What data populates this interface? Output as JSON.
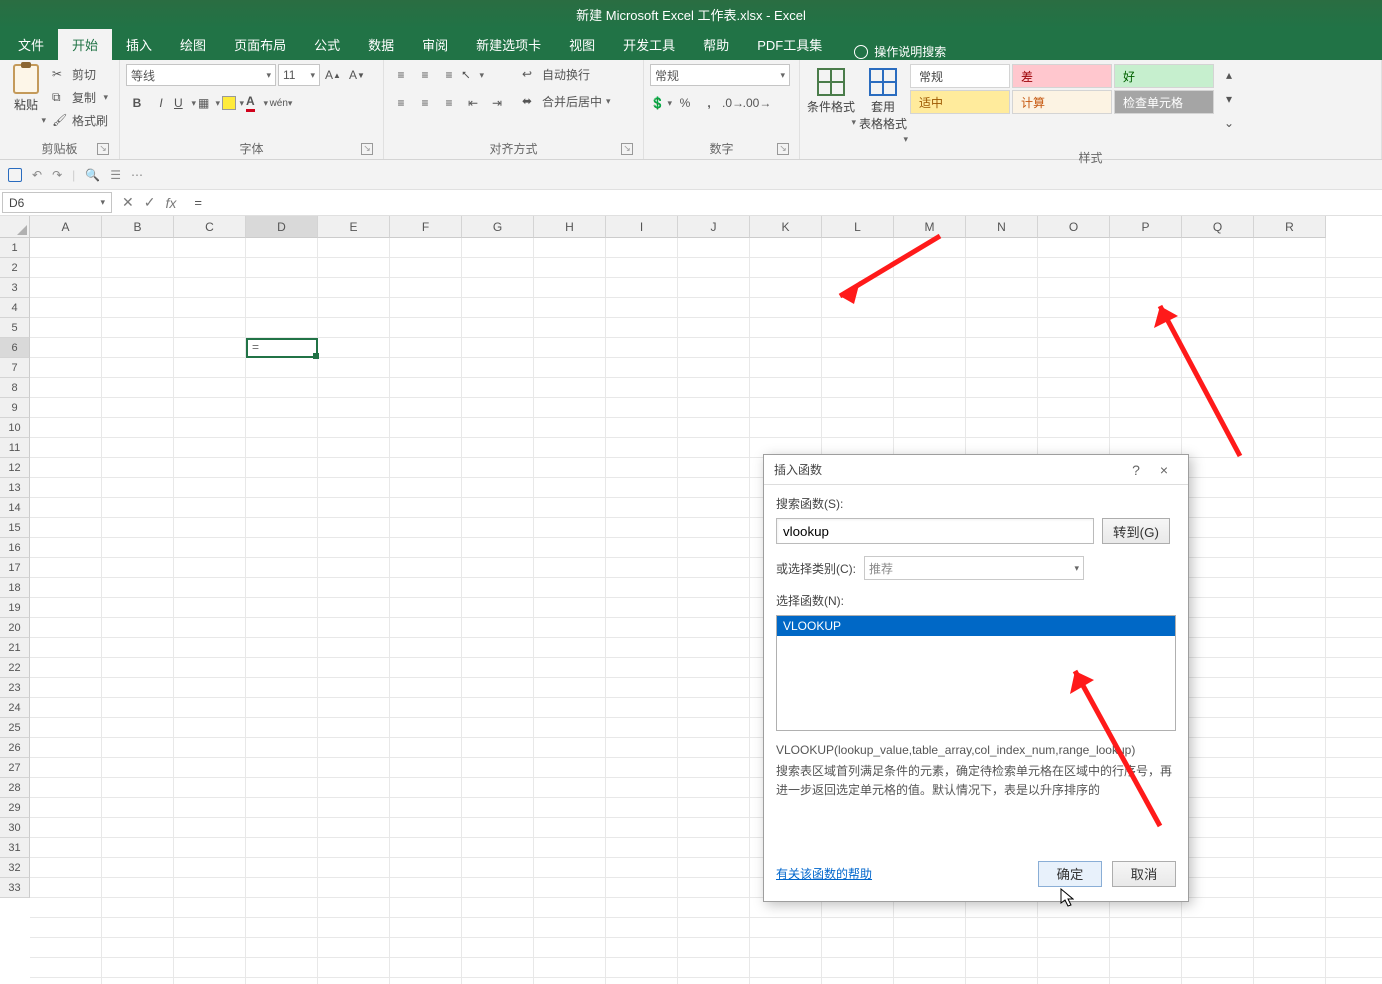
{
  "window": {
    "title": "新建 Microsoft Excel 工作表.xlsx - Excel"
  },
  "tabs": {
    "file": "文件",
    "home": "开始",
    "insert": "插入",
    "draw": "绘图",
    "page_layout": "页面布局",
    "formulas": "公式",
    "data": "数据",
    "review": "审阅",
    "new_tab": "新建选项卡",
    "view": "视图",
    "developer": "开发工具",
    "help": "帮助",
    "pdf": "PDF工具集",
    "tell_me": "操作说明搜索"
  },
  "ribbon": {
    "clipboard": {
      "title": "剪贴板",
      "paste": "粘贴",
      "cut": "剪切",
      "copy": "复制",
      "format_painter": "格式刷"
    },
    "font": {
      "title": "字体",
      "name": "等线",
      "size": "11"
    },
    "alignment": {
      "title": "对齐方式",
      "wrap": "自动换行",
      "merge": "合并后居中"
    },
    "number": {
      "title": "数字",
      "format": "常规"
    },
    "styles": {
      "title": "样式",
      "cond_fmt": "条件格式",
      "table_fmt": "套用\n表格格式",
      "cells": {
        "normal": "常规",
        "bad": "差",
        "good": "好",
        "neutral": "适中",
        "calc": "计算",
        "check": "检查单元格"
      }
    }
  },
  "namebox": "D6",
  "formula": "=",
  "active_cell": {
    "col": "D",
    "row": 6,
    "value": "="
  },
  "columns": [
    "A",
    "B",
    "C",
    "D",
    "E",
    "F",
    "G",
    "H",
    "I",
    "J",
    "Q",
    "R"
  ],
  "rows_visible": 33,
  "dialog": {
    "title": "插入函数",
    "help_icon": "?",
    "close_icon": "×",
    "search_label": "搜索函数(S):",
    "search_value": "vlookup",
    "go_btn": "转到(G)",
    "category_label": "或选择类别(C):",
    "category_value": "推荐",
    "select_label": "选择函数(N):",
    "list_selected": "VLOOKUP",
    "syntax": "VLOOKUP(lookup_value,table_array,col_index_num,range_lookup)",
    "description": "搜索表区域首列满足条件的元素，确定待检索单元格在区域中的行序号，再进一步返回选定单元格的值。默认情况下，表是以升序排序的",
    "help_link": "有关该函数的帮助",
    "ok": "确定",
    "cancel": "取消"
  }
}
